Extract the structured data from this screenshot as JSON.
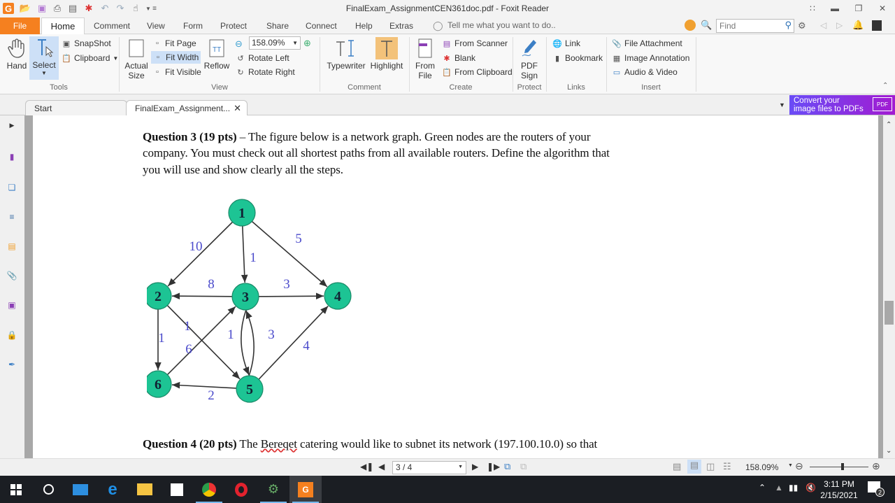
{
  "window": {
    "title": "FinalExam_AssignmentCEN361doc.pdf - Foxit Reader"
  },
  "menu": {
    "tabs": [
      "File",
      "Home",
      "Comment",
      "View",
      "Form",
      "Protect",
      "Share",
      "Connect",
      "Help",
      "Extras"
    ],
    "tell_me_placeholder": "Tell me what you want to do..",
    "find_placeholder": "Find"
  },
  "ribbon": {
    "tools": {
      "label": "Tools",
      "hand": "Hand",
      "select": "Select",
      "snapshot": "SnapShot",
      "clipboard": "Clipboard"
    },
    "view": {
      "label": "View",
      "actual_size_1": "Actual",
      "actual_size_2": "Size",
      "fit_page": "Fit Page",
      "fit_width": "Fit Width",
      "fit_visible": "Fit Visible",
      "reflow": "Reflow",
      "zoom_value": "158.09%",
      "rotate_left": "Rotate Left",
      "rotate_right": "Rotate Right"
    },
    "comment": {
      "label": "Comment",
      "typewriter": "Typewriter",
      "highlight": "Highlight"
    },
    "create": {
      "label": "Create",
      "from_file_1": "From",
      "from_file_2": "File",
      "from_scanner": "From Scanner",
      "blank": "Blank",
      "from_clipboard": "From Clipboard"
    },
    "protect": {
      "label": "Protect",
      "pdf_sign_1": "PDF",
      "pdf_sign_2": "Sign"
    },
    "links": {
      "label": "Links",
      "link": "Link",
      "bookmark": "Bookmark"
    },
    "insert": {
      "label": "Insert",
      "file_attachment": "File Attachment",
      "image_annotation": "Image Annotation",
      "audio_video": "Audio & Video"
    }
  },
  "doc_tabs": [
    {
      "label": "Start"
    },
    {
      "label": "FinalExam_Assignment..."
    }
  ],
  "promo": {
    "line1": "Convert your",
    "line2": "image files to PDFs"
  },
  "document": {
    "q3_bold": "Question 3 (19 pts)",
    "q3_line1": " – The figure below is a network graph. Green nodes are the routers of your",
    "q3_line2": "company. You must check out all shortest paths from all available routers. Define the algorithm that",
    "q3_line3": "you will use and show clearly all the steps.",
    "q4_bold": "Question 4 (20 pts)",
    "q4_pre": " The ",
    "q4_misspelled": "Bereqet",
    "q4_post": " catering would like to subnet its network (197.100.10.0) so that",
    "graph": {
      "node_color": "#1dc494",
      "label_color": "#4a4acb",
      "nodes": [
        {
          "id": "1"
        },
        {
          "id": "2"
        },
        {
          "id": "3"
        },
        {
          "id": "4"
        },
        {
          "id": "5"
        },
        {
          "id": "6"
        }
      ],
      "edges": [
        {
          "from": "1",
          "to": "2",
          "weight": "10"
        },
        {
          "from": "1",
          "to": "3",
          "weight": "1"
        },
        {
          "from": "1",
          "to": "4",
          "weight": "5"
        },
        {
          "from": "3",
          "to": "2",
          "weight": "8"
        },
        {
          "from": "3",
          "to": "4",
          "weight": "3"
        },
        {
          "from": "2",
          "to": "6",
          "weight": "1"
        },
        {
          "from": "2",
          "to": "5",
          "weight": "1"
        },
        {
          "from": "6",
          "to": "3",
          "weight": "6"
        },
        {
          "from": "3",
          "to": "5",
          "weight": "1"
        },
        {
          "from": "5",
          "to": "3",
          "weight": "3"
        },
        {
          "from": "5",
          "to": "4",
          "weight": "4"
        },
        {
          "from": "5",
          "to": "6",
          "weight": "2"
        }
      ]
    }
  },
  "statusbar": {
    "page_value": "3 / 4",
    "zoom_value": "158.09%"
  },
  "taskbar": {
    "time": "3:11 PM",
    "date": "2/15/2021",
    "notifications": "2"
  }
}
